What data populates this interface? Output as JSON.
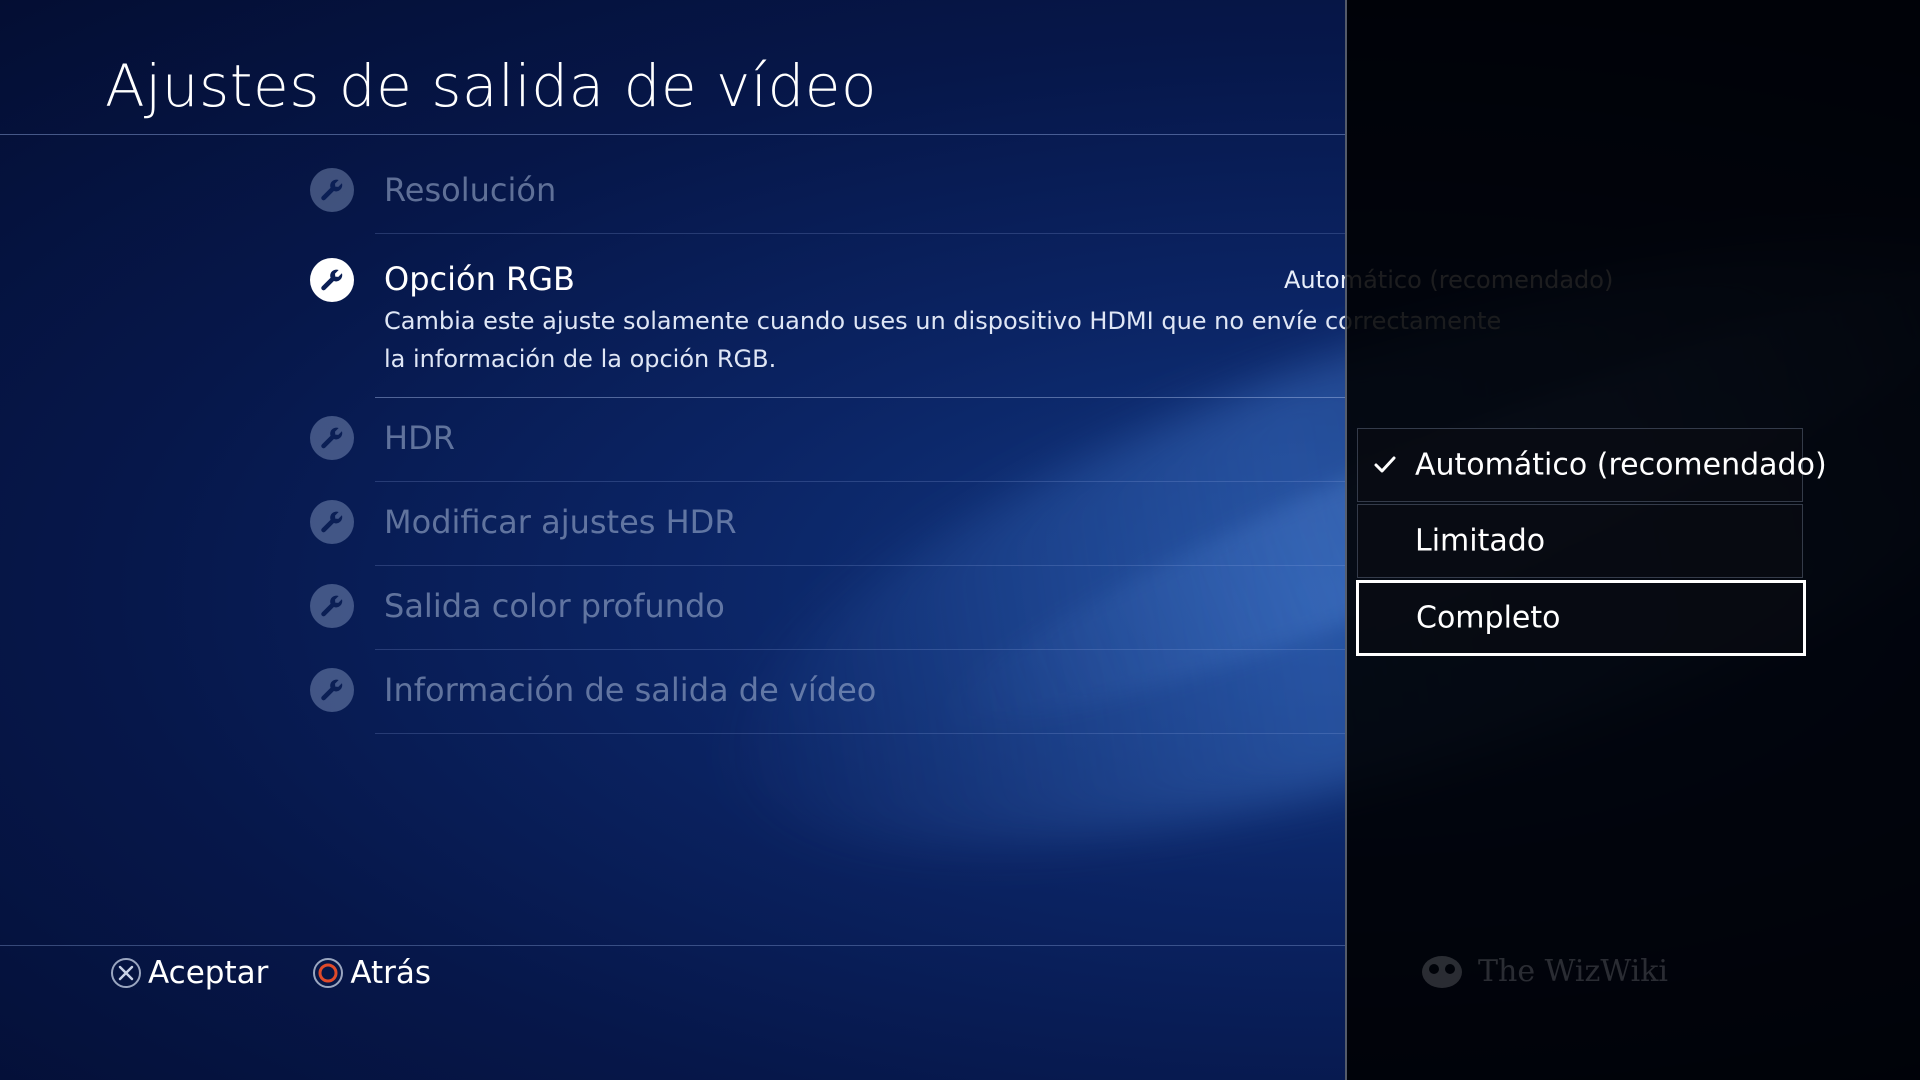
{
  "page": {
    "title": "Ajustes de salida de vídeo"
  },
  "menu": {
    "items": [
      {
        "label": "Resolución",
        "icon": "wrench-icon"
      },
      {
        "label": "Opción RGB",
        "icon": "wrench-icon",
        "value": "Automático (recomendado)",
        "description": "Cambia este ajuste solamente cuando uses un dispositivo HDMI que no envíe correctamente la información de la opción RGB."
      },
      {
        "label": "HDR",
        "icon": "wrench-icon"
      },
      {
        "label": "Modificar ajustes HDR",
        "icon": "wrench-icon"
      },
      {
        "label": "Salida color profundo",
        "icon": "wrench-icon"
      },
      {
        "label": "Información de salida de vídeo",
        "icon": "wrench-icon"
      }
    ]
  },
  "options": {
    "items": [
      {
        "label": "Automático (recomendado)",
        "checked": true
      },
      {
        "label": "Limitado",
        "checked": false
      },
      {
        "label": "Completo",
        "checked": false,
        "focused": true
      }
    ]
  },
  "footer": {
    "accept_label": "Aceptar",
    "accept_icon": "cross-button-icon",
    "back_label": "Atrás",
    "back_icon": "circle-button-icon"
  },
  "watermark": {
    "text": "The WizWiki"
  },
  "colors": {
    "background": "#0b2464",
    "text_active": "#ffffff",
    "text_inactive": "#aab9d7",
    "focus_border": "#ffffff",
    "circle_button": "#e04a2a"
  }
}
